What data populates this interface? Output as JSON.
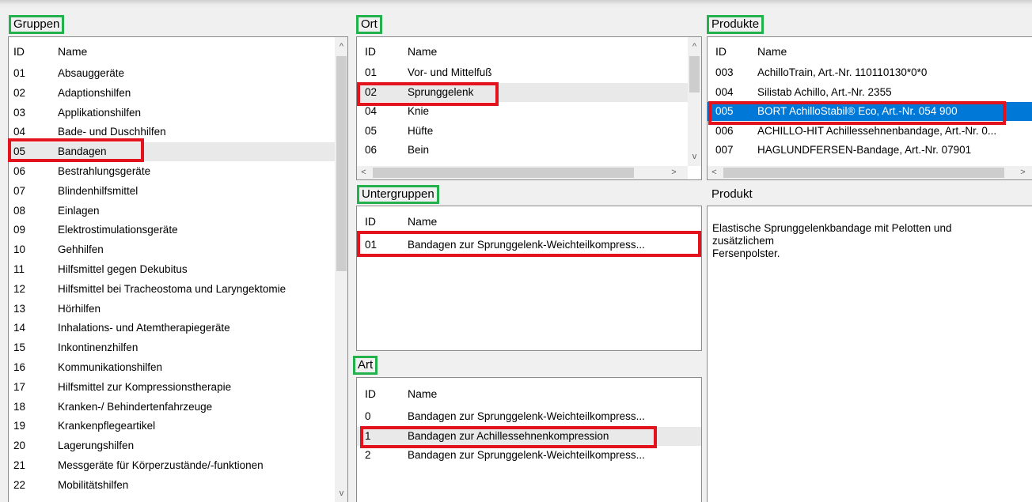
{
  "gruppen": {
    "title": "Gruppen",
    "col_id": "ID",
    "col_name": "Name",
    "rows": [
      {
        "id": "01",
        "name": "Absauggeräte"
      },
      {
        "id": "02",
        "name": "Adaptionshilfen"
      },
      {
        "id": "03",
        "name": "Applikationshilfen"
      },
      {
        "id": "04",
        "name": "Bade- und Duschhilfen"
      },
      {
        "id": "05",
        "name": "Bandagen"
      },
      {
        "id": "06",
        "name": "Bestrahlungsgeräte"
      },
      {
        "id": "07",
        "name": "Blindenhilfsmittel"
      },
      {
        "id": "08",
        "name": "Einlagen"
      },
      {
        "id": "09",
        "name": "Elektrostimulationsgeräte"
      },
      {
        "id": "10",
        "name": "Gehhilfen"
      },
      {
        "id": "11",
        "name": "Hilfsmittel gegen Dekubitus"
      },
      {
        "id": "12",
        "name": "Hilfsmittel bei Tracheostoma und Laryngektomie"
      },
      {
        "id": "13",
        "name": "Hörhilfen"
      },
      {
        "id": "14",
        "name": "Inhalations- und Atemtherapiegeräte"
      },
      {
        "id": "15",
        "name": "Inkontinenzhilfen"
      },
      {
        "id": "16",
        "name": "Kommunikationshilfen"
      },
      {
        "id": "17",
        "name": "Hilfsmittel zur Kompressionstherapie"
      },
      {
        "id": "18",
        "name": "Kranken-/ Behindertenfahrzeuge"
      },
      {
        "id": "19",
        "name": "Krankenpflegeartikel"
      },
      {
        "id": "20",
        "name": "Lagerungshilfen"
      },
      {
        "id": "21",
        "name": "Messgeräte für Körperzustände/-funktionen"
      },
      {
        "id": "22",
        "name": "Mobilitätshilfen"
      }
    ]
  },
  "ort": {
    "title": "Ort",
    "col_id": "ID",
    "col_name": "Name",
    "rows": [
      {
        "id": "01",
        "name": "Vor- und Mittelfuß"
      },
      {
        "id": "02",
        "name": "Sprunggelenk"
      },
      {
        "id": "04",
        "name": "Knie"
      },
      {
        "id": "05",
        "name": "Hüfte"
      },
      {
        "id": "06",
        "name": "Bein"
      }
    ]
  },
  "untergruppen": {
    "title": "Untergruppen",
    "col_id": "ID",
    "col_name": "Name",
    "rows": [
      {
        "id": "01",
        "name": "Bandagen zur Sprunggelenk-Weichteilkompress..."
      }
    ]
  },
  "art": {
    "title": "Art",
    "col_id": "ID",
    "col_name": "Name",
    "rows": [
      {
        "id": "0",
        "name": "Bandagen zur Sprunggelenk-Weichteilkompress..."
      },
      {
        "id": "1",
        "name": "Bandagen zur Achillessehnenkompression"
      },
      {
        "id": "2",
        "name": "Bandagen zur Sprunggelenk-Weichteilkompress..."
      }
    ]
  },
  "produkte": {
    "title": "Produkte",
    "col_id": "ID",
    "col_name": "Name",
    "rows": [
      {
        "id": "003",
        "name": "AchilloTrain, Art.-Nr. 110110130*0*0"
      },
      {
        "id": "004",
        "name": "Silistab Achillo, Art.-Nr. 2355"
      },
      {
        "id": "005",
        "name": "BORT AchilloStabil® Eco, Art.-Nr. 054 900"
      },
      {
        "id": "006",
        "name": "ACHILLO-HIT Achillessehnenbandage, Art.-Nr. 0..."
      },
      {
        "id": "007",
        "name": "HAGLUNDFERSEN-Bandage, Art.-Nr. 07901"
      }
    ]
  },
  "produkt": {
    "title": "Produkt",
    "description": "Elastische Sprunggelenkbandage mit Pelotten und\nzusätzlichem\nFersenpolster."
  },
  "scroll": {
    "up": "^",
    "down": "v",
    "left": "<",
    "right": ">"
  },
  "colors": {
    "highlight_green": "#22b14c",
    "highlight_red": "#e3131e",
    "selection_blue": "#0078d7"
  }
}
